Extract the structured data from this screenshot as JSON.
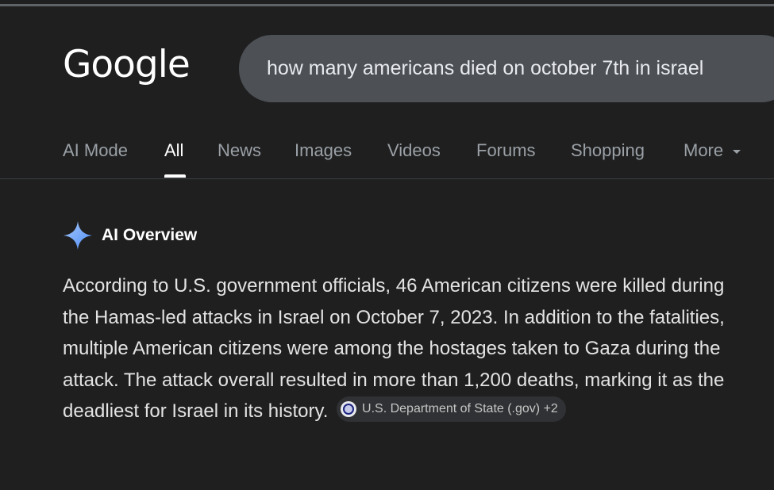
{
  "logo": {
    "text": "Google"
  },
  "search": {
    "query": "how many americans died on october 7th in israel"
  },
  "tabs": [
    {
      "label": "AI Mode"
    },
    {
      "label": "All"
    },
    {
      "label": "News"
    },
    {
      "label": "Images"
    },
    {
      "label": "Videos"
    },
    {
      "label": "Forums"
    },
    {
      "label": "Shopping"
    },
    {
      "label": "More"
    }
  ],
  "ai_overview": {
    "title": "AI Overview",
    "icon": "sparkle-icon",
    "body": "According to U.S. government officials, 46 American citizens were killed during the Hamas-led attacks in Israel on October 7, 2023. In addition to the fatalities, multiple American citizens were among the hostages taken to Gaza during the attack. The attack overall resulted in more than 1,200 deaths, marking it as the deadliest for Israel in its history.",
    "source": {
      "label": "U.S. Department of State (.gov) +2",
      "icon": "state-department-seal-icon"
    }
  },
  "colors": {
    "background": "#1f1f1f",
    "search_box": "#4d5156",
    "tab_inactive": "#9aa0a6",
    "tab_active": "#ffffff",
    "sparkle": "#8ab4f8",
    "chip": "#303134"
  }
}
